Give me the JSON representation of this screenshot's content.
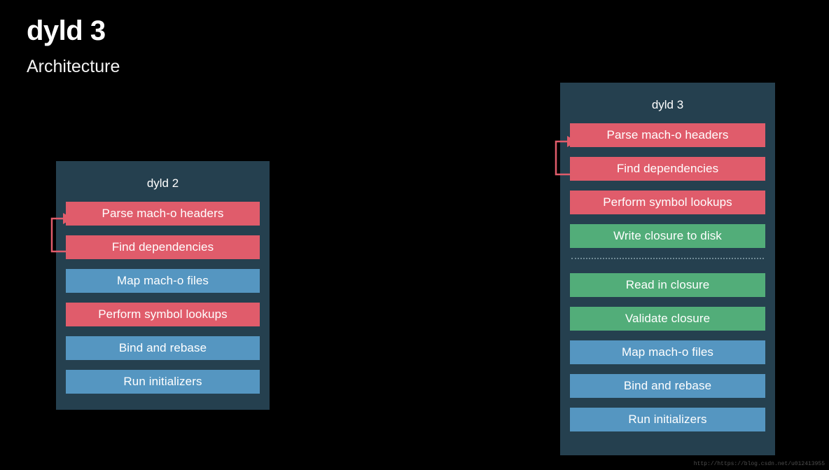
{
  "slide": {
    "title": "dyld 3",
    "subtitle": "Architecture",
    "background_color": "#000000"
  },
  "colors": {
    "panel_background": "#25404f",
    "red": "#e05c6b",
    "blue": "#5596c1",
    "green": "#52ad79",
    "arrow": "#e05c6b",
    "divider": "#7e97a3",
    "text": "#ffffff"
  },
  "panels": [
    {
      "id": "dyld2",
      "title": "dyld 2",
      "steps": [
        {
          "label": "Parse mach-o headers",
          "color": "red"
        },
        {
          "label": "Find dependencies",
          "color": "red"
        },
        {
          "label": "Map mach-o files",
          "color": "blue"
        },
        {
          "label": "Perform symbol lookups",
          "color": "red"
        },
        {
          "label": "Bind and rebase",
          "color": "blue"
        },
        {
          "label": "Run initializers",
          "color": "blue"
        }
      ],
      "loop_arrow": {
        "from_step": "Find dependencies",
        "to_step": "Parse mach-o headers",
        "icon": "loop-arrow-icon"
      }
    },
    {
      "id": "dyld3",
      "title": "dyld 3",
      "steps_top": [
        {
          "label": "Parse mach-o headers",
          "color": "red"
        },
        {
          "label": "Find dependencies",
          "color": "red"
        },
        {
          "label": "Perform symbol lookups",
          "color": "red"
        },
        {
          "label": "Write closure to disk",
          "color": "green"
        }
      ],
      "divider": "dashed",
      "steps_bottom": [
        {
          "label": "Read in closure",
          "color": "green"
        },
        {
          "label": "Validate closure",
          "color": "green"
        },
        {
          "label": "Map mach-o files",
          "color": "blue"
        },
        {
          "label": "Bind and rebase",
          "color": "blue"
        },
        {
          "label": "Run initializers",
          "color": "blue"
        }
      ],
      "loop_arrow": {
        "from_step": "Find dependencies",
        "to_step": "Parse mach-o headers",
        "icon": "loop-arrow-icon"
      }
    }
  ],
  "watermark": {
    "text": "http://https://blog.csdn.net/u012413955"
  }
}
